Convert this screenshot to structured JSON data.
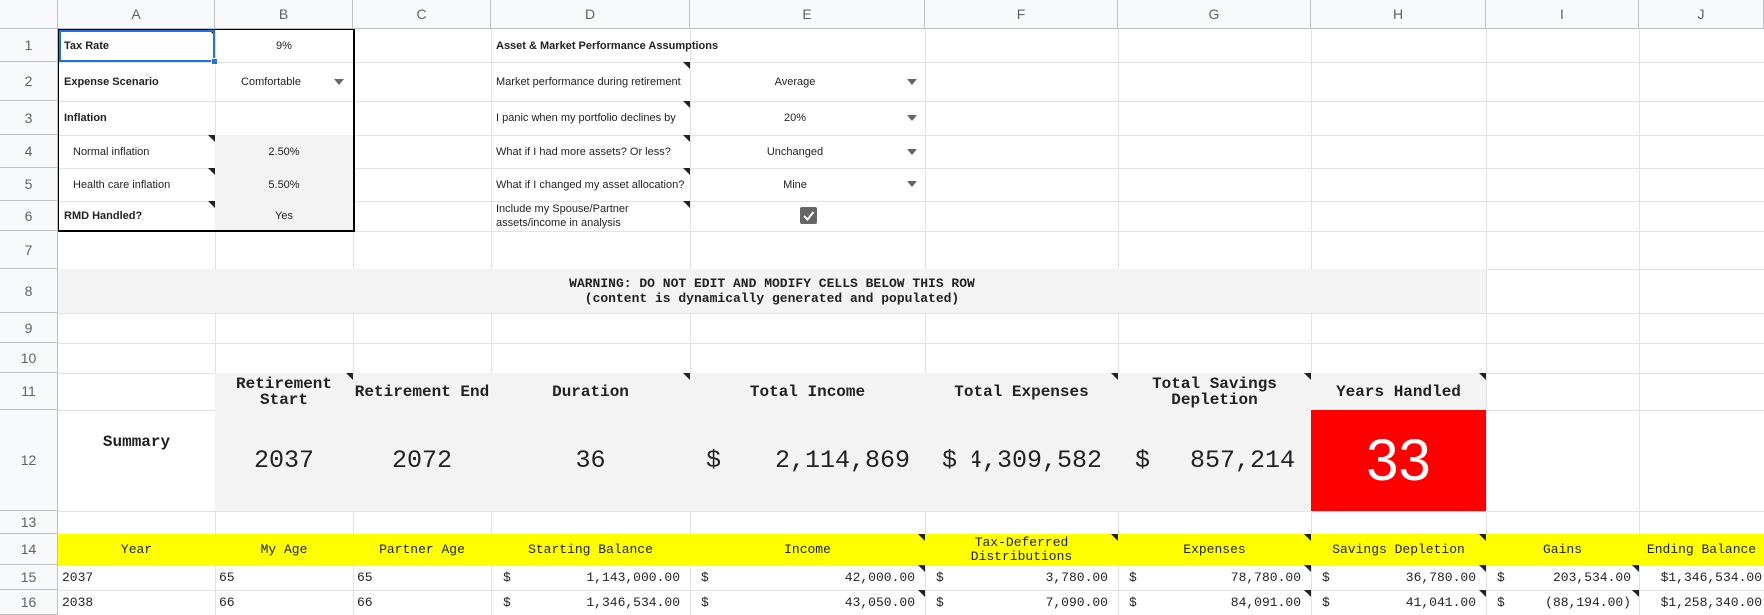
{
  "column_headers": [
    "A",
    "B",
    "C",
    "D",
    "E",
    "F",
    "G",
    "H",
    "I",
    "J"
  ],
  "row_headers": [
    "1",
    "2",
    "3",
    "4",
    "5",
    "6",
    "7",
    "8",
    "9",
    "10",
    "11",
    "12",
    "13",
    "14",
    "15",
    "16"
  ],
  "settings": {
    "tax_rate_label": "Tax Rate",
    "tax_rate_value": "9%",
    "expense_label": "Expense Scenario",
    "expense_value": "Comfortable",
    "inflation_label": "Inflation",
    "normal_inflation_label": "Normal inflation",
    "normal_inflation_value": "2.50%",
    "health_inflation_label": "Health care inflation",
    "health_inflation_value": "5.50%",
    "rmd_label": "RMD Handled?",
    "rmd_value": "Yes"
  },
  "assumptions": {
    "title": "Asset  & Market Performance Assumptions",
    "market_perf_label": "Market performance during retirement",
    "market_perf_value": "Average",
    "panic_label": "I panic when my portfolio declines by",
    "panic_value": "20%",
    "more_assets_label": "What if I had more assets? Or less?",
    "more_assets_value": "Unchanged",
    "allocation_label": "What if I changed my asset allocation?",
    "allocation_value": "Mine",
    "spouse_label": "Include my Spouse/Partner assets/income in analysis",
    "spouse_checked": true
  },
  "warning": {
    "line1": "WARNING:  DO NOT EDIT AND MODIFY CELLS BELOW THIS ROW",
    "line2": "(content is dynamically generated and populated)"
  },
  "summary": {
    "label": "Summary",
    "headers": {
      "start": "Retirement Start",
      "end": "Retirement End",
      "duration": "Duration",
      "income": "Total Income",
      "expenses": "Total Expenses",
      "depletion": "Total Savings Depletion",
      "years": "Years Handled"
    },
    "values": {
      "start": "2037",
      "end": "2072",
      "duration": "36",
      "income_cur": "$",
      "income": "2,114,869",
      "expenses_cur": "$",
      "expenses": "4,309,582",
      "depletion_cur": "$",
      "depletion": "857,214",
      "years": "33"
    },
    "years_color": "#ff0000"
  },
  "table": {
    "headers": [
      "Year",
      "My Age",
      "Partner Age",
      "Starting Balance",
      "Income",
      "Tax-Deferred Distributions",
      "Expenses",
      "Savings Depletion",
      "Gains",
      "Ending Balance"
    ],
    "rows": [
      {
        "year": "2037",
        "my_age": "65",
        "partner_age": "65",
        "starting_balance": "1,143,000.00",
        "income": "42,000.00",
        "tax_deferred": "3,780.00",
        "expenses": "78,780.00",
        "savings_depletion": "36,780.00",
        "gains": "203,534.00",
        "ending_balance": "$1,346,534.00"
      },
      {
        "year": "2038",
        "my_age": "66",
        "partner_age": "66",
        "starting_balance": "1,346,534.00",
        "income": "43,050.00",
        "tax_deferred": "7,090.00",
        "expenses": "84,091.00",
        "savings_depletion": "41,041.00",
        "gains": "(88,194.00)",
        "ending_balance": "$1,258,340.00"
      }
    ],
    "currency": "$"
  },
  "colors": {
    "header_yellow": "#ffff00",
    "grid_line": "#e2e2e2",
    "gray_fill": "#f3f3f3"
  }
}
